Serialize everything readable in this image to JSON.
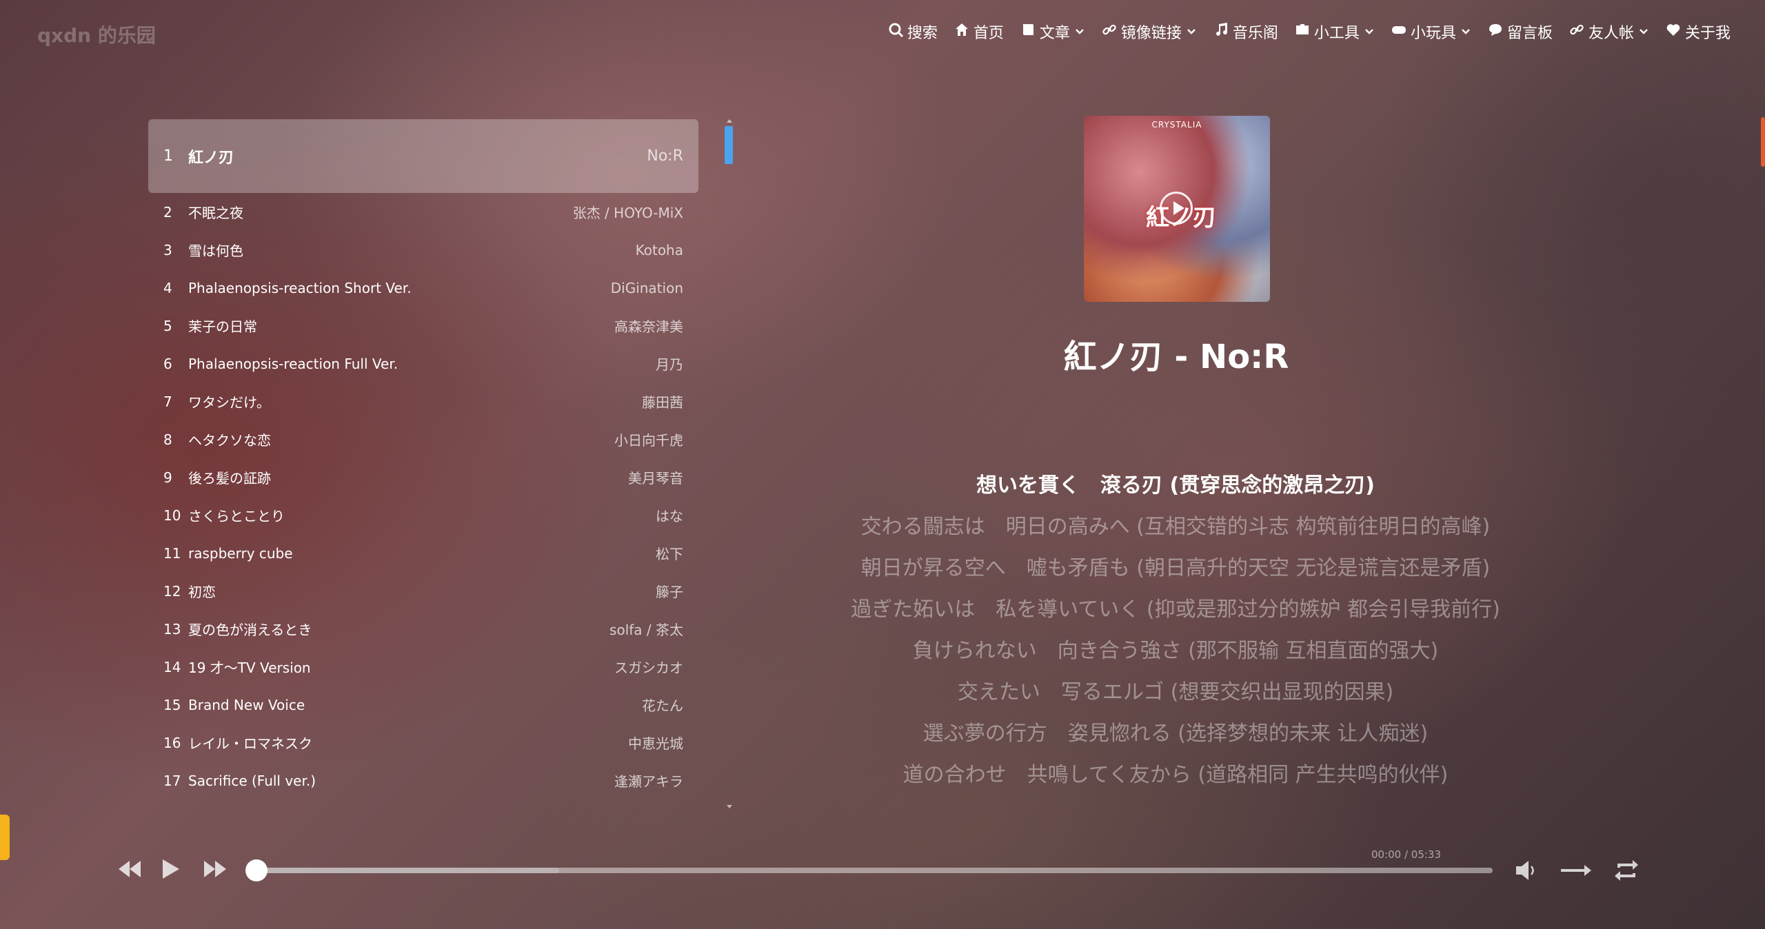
{
  "site": {
    "title": "qxdn 的乐园"
  },
  "nav": [
    {
      "label": "搜索",
      "icon": "search-icon",
      "dropdown": false
    },
    {
      "label": "首页",
      "icon": "home-icon",
      "dropdown": false
    },
    {
      "label": "文章",
      "icon": "book-icon",
      "dropdown": true
    },
    {
      "label": "镜像链接",
      "icon": "link-icon",
      "dropdown": true
    },
    {
      "label": "音乐阁",
      "icon": "music-icon",
      "dropdown": false
    },
    {
      "label": "小工具",
      "icon": "toolbox-icon",
      "dropdown": true
    },
    {
      "label": "小玩具",
      "icon": "gamepad-icon",
      "dropdown": true
    },
    {
      "label": "留言板",
      "icon": "comment-icon",
      "dropdown": false
    },
    {
      "label": "友人帐",
      "icon": "link-icon",
      "dropdown": true
    },
    {
      "label": "关于我",
      "icon": "heart-icon",
      "dropdown": false
    }
  ],
  "playlist": [
    {
      "index": "1",
      "title": "紅ノ刃",
      "artist": "No:R",
      "active": true
    },
    {
      "index": "2",
      "title": "不眠之夜",
      "artist": "张杰 / HOYO-MiX"
    },
    {
      "index": "3",
      "title": "雪は何色",
      "artist": "Kotoha"
    },
    {
      "index": "4",
      "title": "Phalaenopsis-reaction Short Ver.",
      "artist": "DiGination"
    },
    {
      "index": "5",
      "title": "茉子の日常",
      "artist": "高森奈津美"
    },
    {
      "index": "6",
      "title": "Phalaenopsis-reaction Full Ver.",
      "artist": "月乃"
    },
    {
      "index": "7",
      "title": "ワタシだけ。",
      "artist": "藤田茜"
    },
    {
      "index": "8",
      "title": "ヘタクソな恋",
      "artist": "小日向千虎"
    },
    {
      "index": "9",
      "title": "後ろ髪の証跡",
      "artist": "美月琴音"
    },
    {
      "index": "10",
      "title": "さくらとことり",
      "artist": "はな"
    },
    {
      "index": "11",
      "title": "raspberry cube",
      "artist": "松下"
    },
    {
      "index": "12",
      "title": "初恋",
      "artist": "籐子"
    },
    {
      "index": "13",
      "title": "夏の色が消えるとき",
      "artist": "solfa / 茶太"
    },
    {
      "index": "14",
      "title": "19 才～TV Version",
      "artist": "スガシカオ"
    },
    {
      "index": "15",
      "title": "Brand New Voice",
      "artist": "花たん"
    },
    {
      "index": "16",
      "title": "レイル・ロマネスク",
      "artist": "中恵光城"
    },
    {
      "index": "17",
      "title": "Sacrifice (Full ver.)",
      "artist": "逢瀬アキラ"
    }
  ],
  "now_playing": {
    "title": "紅ノ刃 - No:R",
    "cover_brand": "CRYSTALIA",
    "cover_text": "紅ノ刃"
  },
  "lyrics": [
    {
      "text": "想いを貫く　滾る刃 (贯穿思念的激昂之刃)",
      "current": true
    },
    {
      "text": "交わる闘志は　明日の高みへ (互相交错的斗志 构筑前往明日的高峰)"
    },
    {
      "text": "朝日が昇る空へ　嘘も矛盾も (朝日高升的天空 无论是谎言还是矛盾)"
    },
    {
      "text": "過ぎた妬いは　私を導いていく (抑或是那过分的嫉妒 都会引导我前行)"
    },
    {
      "text": "負けられない　向き合う強さ (那不服输 互相直面的强大)"
    },
    {
      "text": "交えたい　写るエルゴ (想要交织出显现的因果)"
    },
    {
      "text": "選ぶ夢の行方　姿見惚れる (选择梦想的未来 让人痴迷)"
    },
    {
      "text": "道の合わせ　共鳴してく友から (道路相同 产生共鸣的伙伴)"
    }
  ],
  "player": {
    "time": "00:00 / 05:33",
    "progress": 0.0,
    "buffered": 0.245
  }
}
